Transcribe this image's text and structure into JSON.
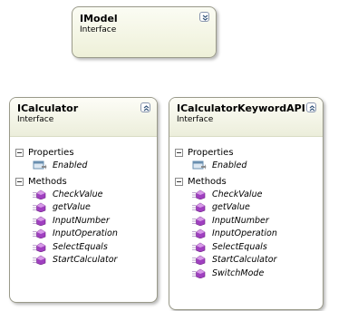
{
  "diagram": {
    "boxes": [
      {
        "name": "IModel",
        "stereotype": "Interface",
        "collapsed": true
      },
      {
        "name": "ICalculator",
        "stereotype": "Interface",
        "collapsed": false,
        "sections": [
          {
            "label": "Properties",
            "items": [
              "Enabled"
            ]
          },
          {
            "label": "Methods",
            "items": [
              "CheckValue",
              "getValue",
              "InputNumber",
              "InputOperation",
              "SelectEquals",
              "StartCalculator"
            ]
          }
        ]
      },
      {
        "name": "ICalculatorKeywordAPI",
        "stereotype": "Interface",
        "collapsed": false,
        "sections": [
          {
            "label": "Properties",
            "items": [
              "Enabled"
            ]
          },
          {
            "label": "Methods",
            "items": [
              "CheckValue",
              "getValue",
              "InputNumber",
              "InputOperation",
              "SelectEquals",
              "StartCalculator",
              "SwitchMode"
            ]
          }
        ]
      }
    ]
  },
  "colors": {
    "method_icon": "#a040c0",
    "property_icon": "#6a8fb0",
    "header_gradient_top": "#fdfdf7",
    "header_gradient_bottom": "#eceedb"
  },
  "icons": {
    "expand": "chevron-down-double-icon",
    "collapse": "chevron-up-double-icon",
    "property": "property-icon",
    "method": "method-icon",
    "section_toggle": "minus-icon"
  }
}
